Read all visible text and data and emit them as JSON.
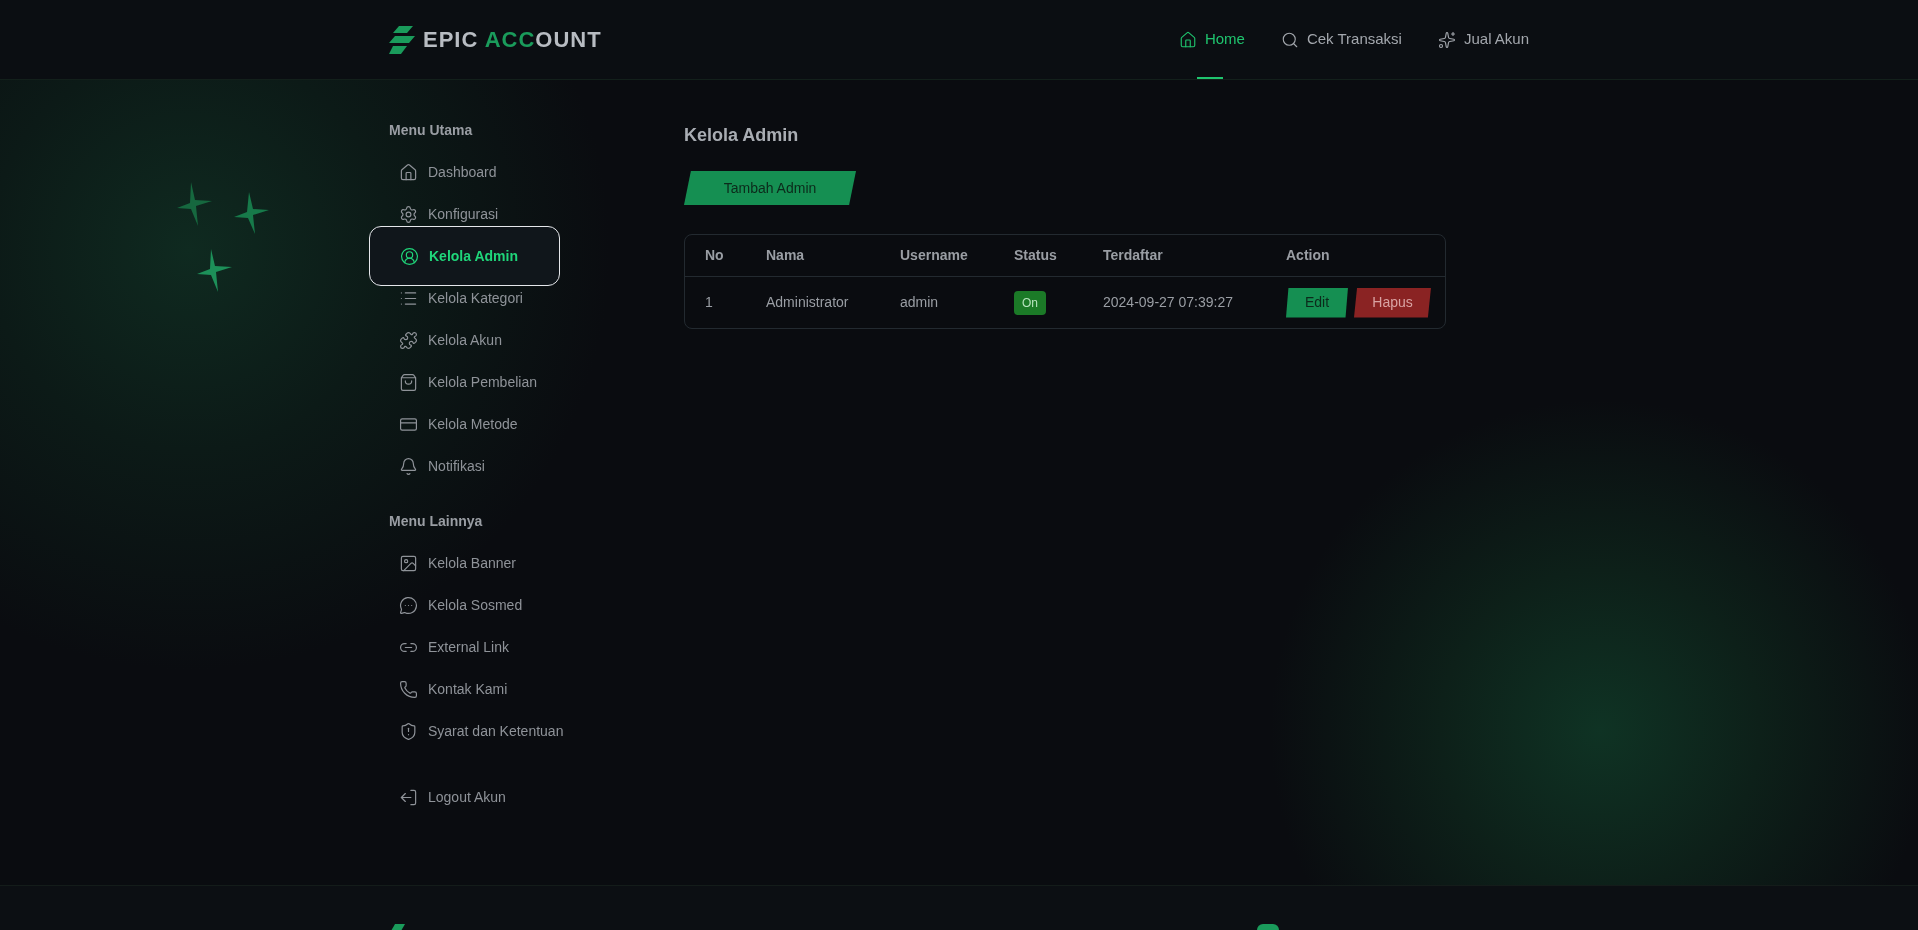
{
  "logo": {
    "parts": [
      "EPIC ",
      "ACC",
      "OUNT"
    ]
  },
  "nav": [
    {
      "label": "Home",
      "selected": true
    },
    {
      "label": "Cek Transaksi",
      "selected": false
    },
    {
      "label": "Jual Akun",
      "selected": false
    }
  ],
  "sidebar": {
    "sections": [
      {
        "heading": "Menu Utama",
        "items": [
          {
            "label": "Dashboard",
            "selected": false
          },
          {
            "label": "Konfigurasi",
            "selected": false
          },
          {
            "label": "Kelola Admin",
            "selected": true
          },
          {
            "label": "Kelola Kategori",
            "selected": false
          },
          {
            "label": "Kelola Akun",
            "selected": false
          },
          {
            "label": "Kelola Pembelian",
            "selected": false
          },
          {
            "label": "Kelola Metode",
            "selected": false
          },
          {
            "label": "Notifikasi",
            "selected": false
          }
        ]
      },
      {
        "heading": "Menu Lainnya",
        "items": [
          {
            "label": "Kelola Banner",
            "selected": false
          },
          {
            "label": "Kelola Sosmed",
            "selected": false
          },
          {
            "label": "External Link",
            "selected": false
          },
          {
            "label": "Kontak Kami",
            "selected": false
          },
          {
            "label": "Syarat dan Ketentuan",
            "selected": false
          }
        ]
      }
    ],
    "logout": "Logout Akun"
  },
  "page": {
    "title": "Kelola Admin",
    "add_button": "Tambah Admin"
  },
  "table": {
    "columns": [
      "No",
      "Nama",
      "Username",
      "Status",
      "Terdaftar",
      "Action"
    ],
    "rows": [
      {
        "no": "1",
        "nama": "Administrator",
        "username": "admin",
        "status": "On",
        "terdaftar": "2024-09-27 07:39:27",
        "actions": [
          "Edit",
          "Hapus"
        ]
      }
    ]
  }
}
